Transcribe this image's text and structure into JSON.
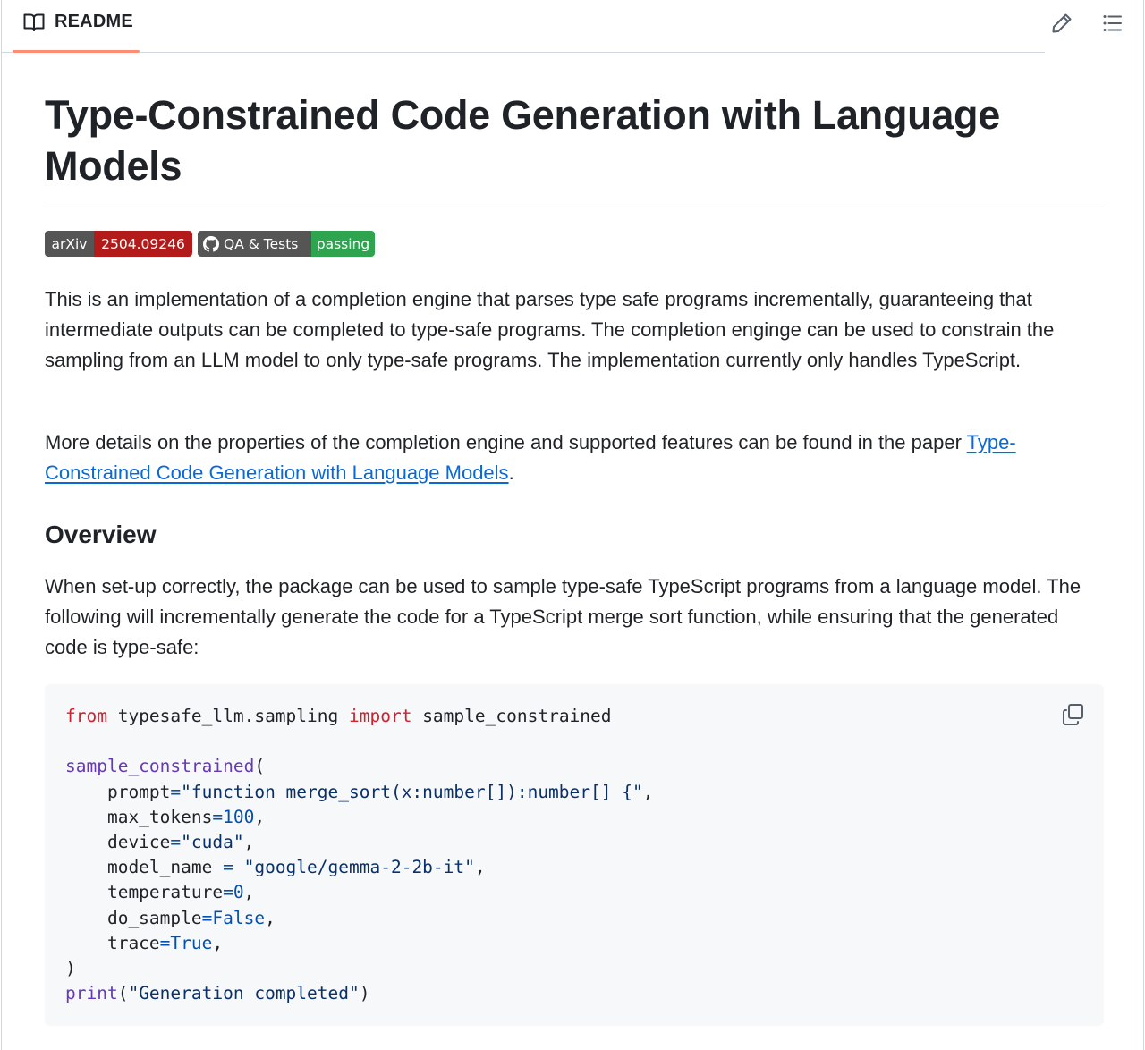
{
  "header": {
    "tab_label": "README",
    "icons": {
      "tab": "book-icon",
      "edit": "pencil-icon",
      "outline": "list-icon"
    }
  },
  "article": {
    "title": "Type-Constrained Code Generation with Language Models",
    "badges": [
      {
        "left": "arXiv",
        "right": "2504.09246",
        "right_color": "#b31b1b"
      },
      {
        "left": "QA & Tests",
        "right": "passing",
        "right_color": "#2ea44f",
        "icon": "github-icon"
      }
    ],
    "paragraph1": "This is an implementation of a completion engine that parses type safe programs incrementally, guaranteeing that intermediate outputs can be completed to type-safe programs. The completion enginge can be used to constrain the sampling from an LLM model to only type-safe programs. The implementation currently only handles TypeScript.",
    "paragraph2_text": "More details on the properties of the completion engine and supported features can be found in the paper ",
    "paragraph2_link": "Type-Constrained Code Generation with Language Models",
    "paragraph2_end": ".",
    "section_heading": "Overview",
    "paragraph3": "When set-up correctly, the package can be used to sample type-safe TypeScript programs from a language model. The following will incrementally generate the code for a TypeScript merge sort function, while ensuring that the generated code is type-safe:"
  },
  "code": {
    "kw_from": "from",
    "module": " typesafe_llm.sampling ",
    "kw_import": "import",
    "imported": " sample_constrained",
    "call_fn": "sample_constrained",
    "args": [
      {
        "name": "    prompt",
        "op": "=",
        "value": "\"function merge_sort(x:number[]):number[] {\"",
        "kind": "str"
      },
      {
        "name": "    max_tokens",
        "op": "=",
        "value": "100",
        "kind": "num"
      },
      {
        "name": "    device",
        "op": "=",
        "value": "\"cuda\"",
        "kind": "str"
      },
      {
        "name": "    model_name ",
        "op": "=",
        "value": " \"google/gemma-2-2b-it\"",
        "kind": "str"
      },
      {
        "name": "    temperature",
        "op": "=",
        "value": "0",
        "kind": "num"
      },
      {
        "name": "    do_sample",
        "op": "=",
        "value": "False",
        "kind": "num"
      },
      {
        "name": "    trace",
        "op": "=",
        "value": "True",
        "kind": "num"
      }
    ],
    "close": ")",
    "print_fn": "print",
    "print_arg": "\"Generation completed\"",
    "copy_icon": "copy-icon"
  }
}
